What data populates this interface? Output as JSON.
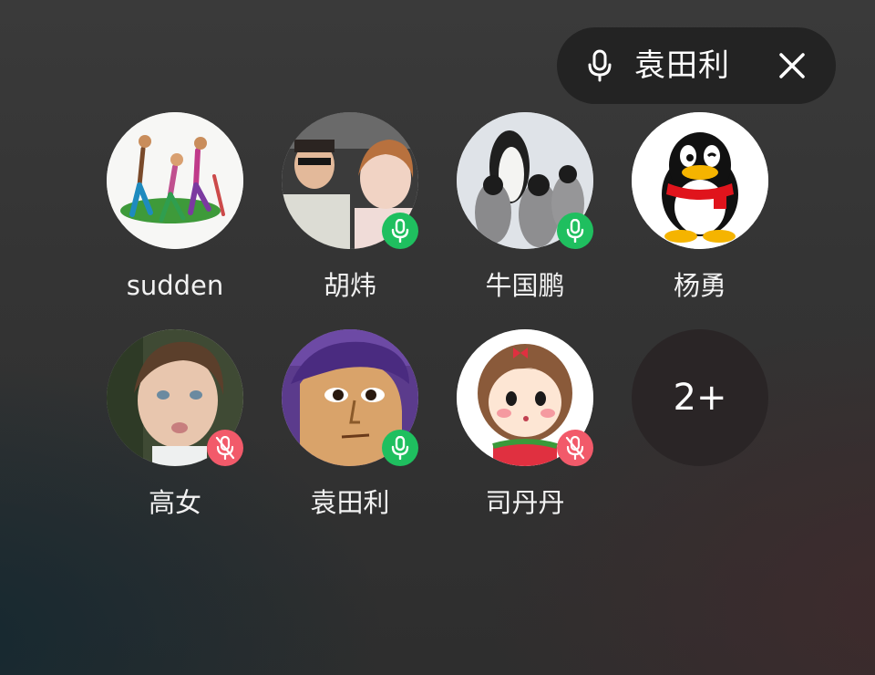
{
  "speaker": {
    "name": "袁田利",
    "mic_icon": "microphone-icon",
    "close_icon": "close-icon"
  },
  "participants": [
    {
      "name": "sudden",
      "avatar": "running-figures-avatar",
      "mic": "none"
    },
    {
      "name": "胡炜",
      "avatar": "selfie-photo-avatar",
      "mic": "on"
    },
    {
      "name": "牛国鹏",
      "avatar": "penguins-avatar",
      "mic": "on"
    },
    {
      "name": "杨勇",
      "avatar": "qq-penguin-avatar",
      "mic": "none"
    },
    {
      "name": "高女",
      "avatar": "child-photo-avatar",
      "mic": "muted"
    },
    {
      "name": "袁田利",
      "avatar": "cartoon-man-avatar",
      "mic": "on"
    },
    {
      "name": "司丹丹",
      "avatar": "cartoon-girl-avatar",
      "mic": "muted"
    }
  ],
  "more": {
    "label": "2+"
  },
  "colors": {
    "mic_on": "#1fbf5f",
    "mic_muted": "#f25a6a",
    "pill_bg": "#1e1e1e"
  }
}
